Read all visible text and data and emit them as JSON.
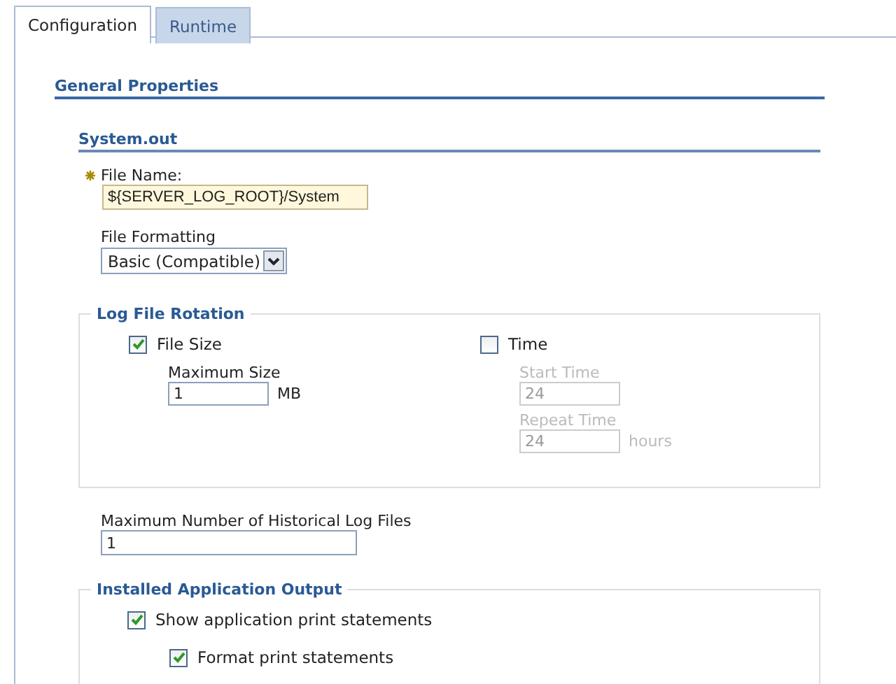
{
  "tabs": [
    {
      "label": "Configuration",
      "selected": true
    },
    {
      "label": "Runtime",
      "selected": false
    }
  ],
  "section_title": "General Properties",
  "subsection_title": "System.out",
  "file_name": {
    "label": "File Name:",
    "required": true,
    "value": "${SERVER_LOG_ROOT}/System"
  },
  "file_formatting": {
    "label": "File Formatting",
    "value": "Basic (Compatible)"
  },
  "log_file_rotation": {
    "legend": "Log File Rotation",
    "file_size": {
      "label": "File Size",
      "checked": true,
      "field_label": "Maximum Size",
      "value": "1",
      "unit": "MB",
      "disabled": false
    },
    "time": {
      "label": "Time",
      "checked": false,
      "disabled": true,
      "start_label": "Start Time",
      "start_value": "24",
      "repeat_label": "Repeat Time",
      "repeat_value": "24",
      "unit": "hours"
    }
  },
  "historical_files": {
    "label": "Maximum Number of Historical Log Files",
    "value": "1"
  },
  "installed_application_output": {
    "legend": "Installed Application Output",
    "options": [
      {
        "label": "Show application print statements",
        "checked": true
      },
      {
        "label": "Format print statements",
        "checked": true
      }
    ]
  }
}
